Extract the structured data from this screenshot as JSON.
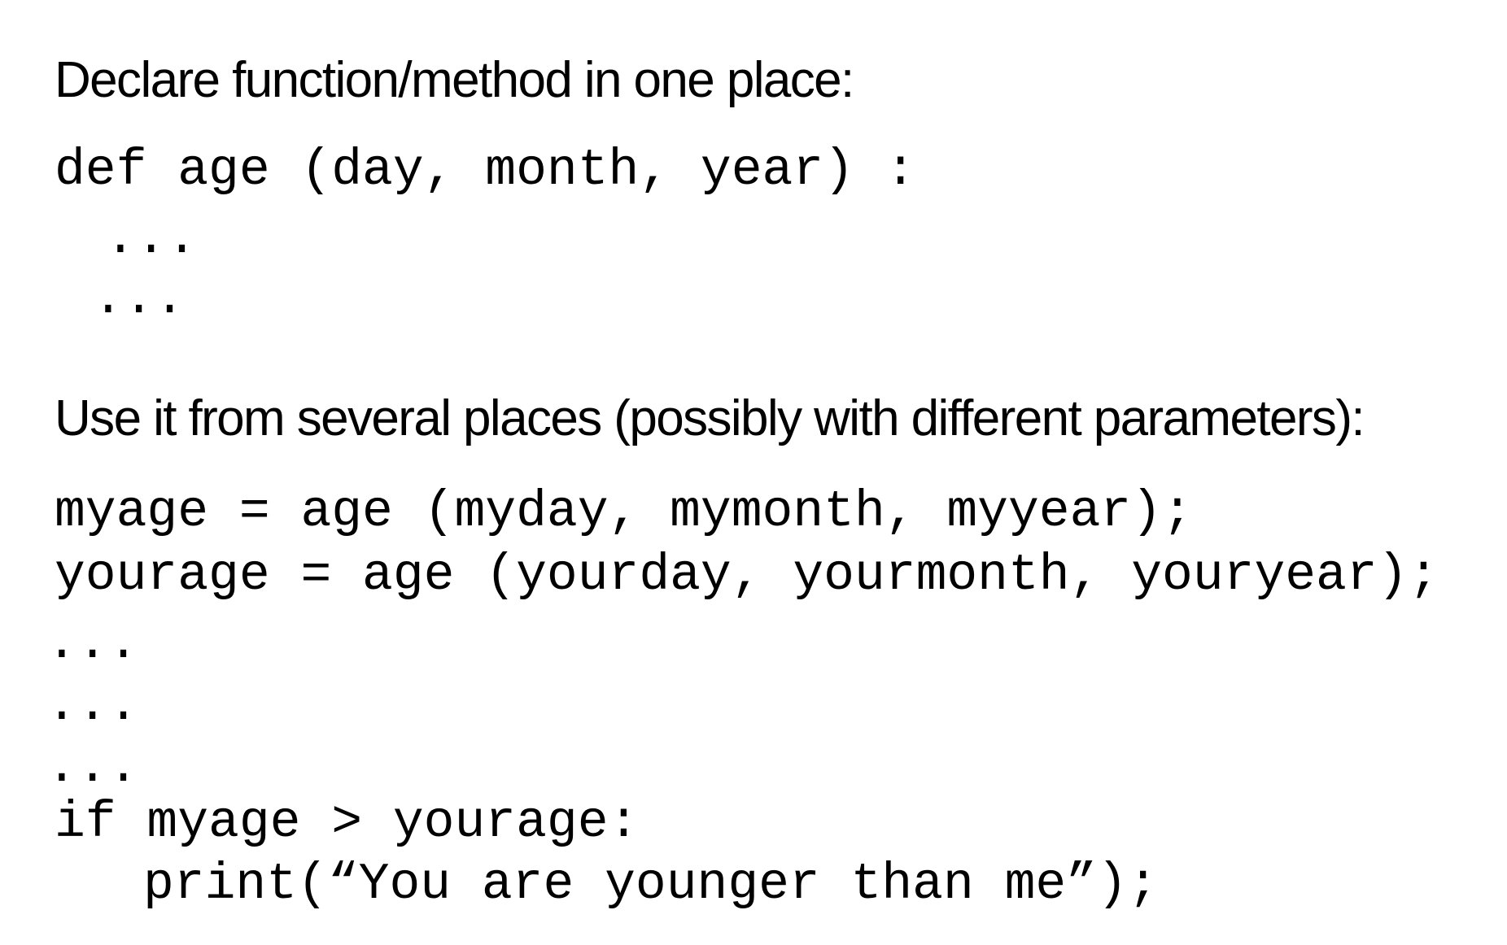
{
  "heading_declare": "Declare function/method in one place:",
  "declare_code": {
    "line_1": "def age (day, month, year) :",
    "line_2": "...",
    "line_3": "..."
  },
  "heading_use": "Use it from several places (possibly with different parameters):",
  "use_code": {
    "line_1": "myage = age (myday, mymonth, myyear);",
    "line_2": "yourage = age (yourday, yourmonth, youryear);",
    "line_3": "...",
    "line_4": "...",
    "line_5": "...",
    "line_6": "if myage > yourage:",
    "line_7": "print(“You are younger than me”);"
  }
}
